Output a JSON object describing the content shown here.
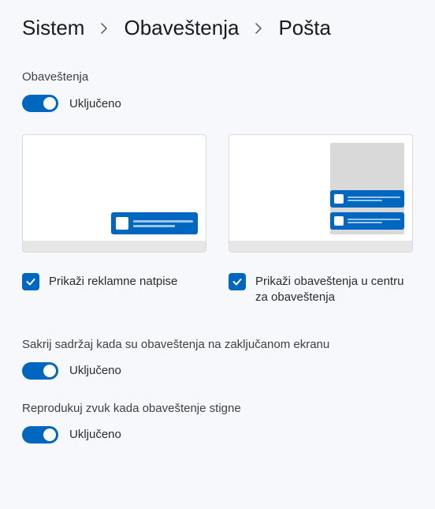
{
  "breadcrumb": {
    "item1": "Sistem",
    "item2": "Obaveštenja",
    "item3": "Pošta"
  },
  "notifications": {
    "label": "Obaveštenja",
    "state_text": "Uključeno"
  },
  "options": {
    "show_banners": "Prikaži reklamne natpise",
    "show_action_center": "Prikaži obaveštenja u centru za obaveštenja"
  },
  "hide_content": {
    "label": "Sakrij sadržaj kada su obaveštenja na zaključanom ekranu",
    "state_text": "Uključeno"
  },
  "play_sound": {
    "label": "Reprodukuj zvuk kada obaveštenje stigne",
    "state_text": "Uključeno"
  }
}
